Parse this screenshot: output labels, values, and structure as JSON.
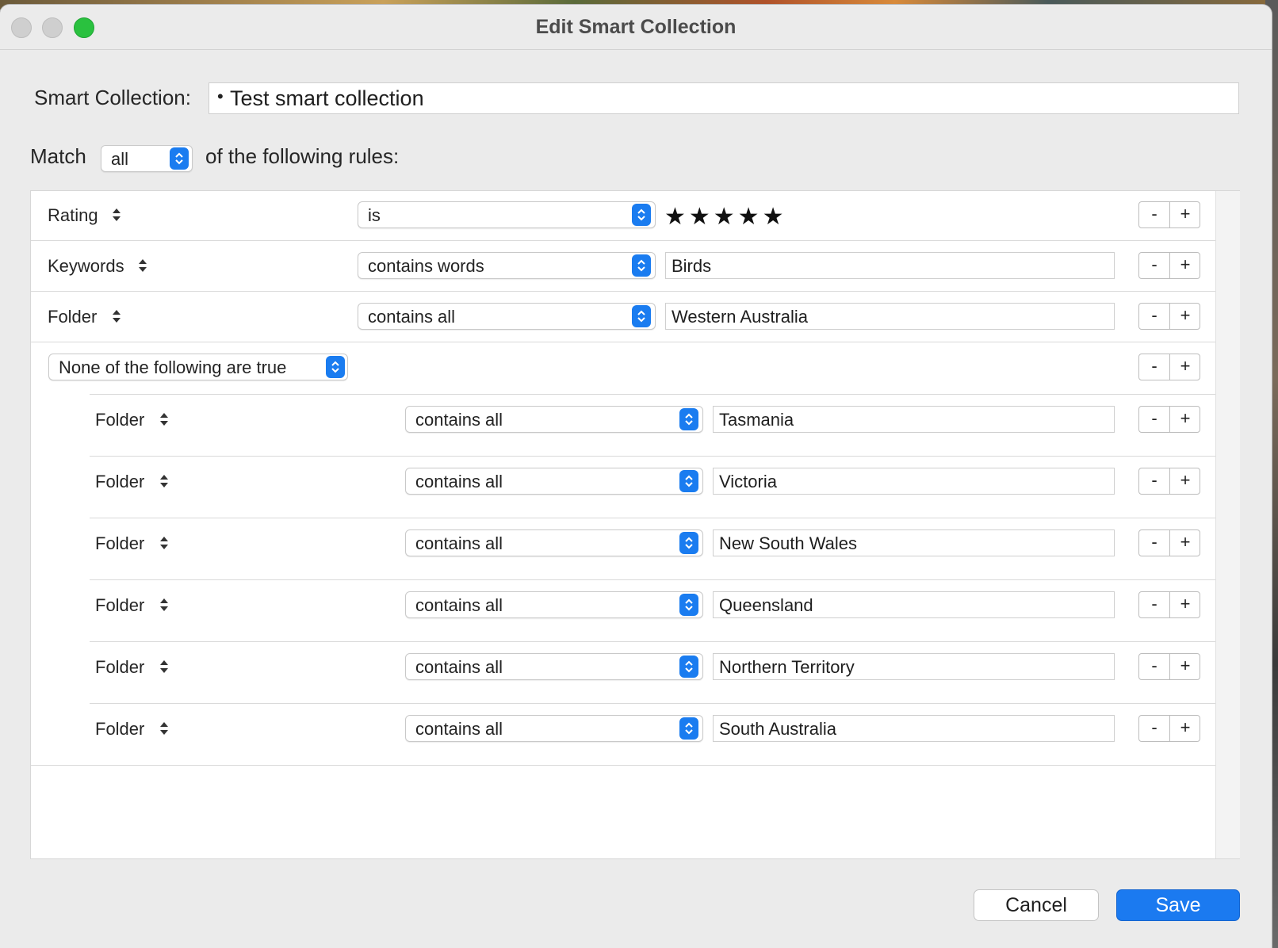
{
  "window": {
    "title": "Edit Smart Collection"
  },
  "name": {
    "label": "Smart Collection:",
    "bullet": "•",
    "value": "Test smart collection"
  },
  "match": {
    "prefix": "Match",
    "value": "all",
    "suffix": "of the following rules:"
  },
  "rules": [
    {
      "criterion": "Rating",
      "operator": "is",
      "stars": "★★★★★",
      "rating": 5
    },
    {
      "criterion": "Keywords",
      "operator": "contains words",
      "value": "Birds"
    },
    {
      "criterion": "Folder",
      "operator": "contains all",
      "value": "Western Australia"
    }
  ],
  "group": {
    "selector": "None of the following are true",
    "rules": [
      {
        "criterion": "Folder",
        "operator": "contains all",
        "value": "Tasmania"
      },
      {
        "criterion": "Folder",
        "operator": "contains all",
        "value": "Victoria"
      },
      {
        "criterion": "Folder",
        "operator": "contains all",
        "value": "New South Wales"
      },
      {
        "criterion": "Folder",
        "operator": "contains all",
        "value": "Queensland"
      },
      {
        "criterion": "Folder",
        "operator": "contains all",
        "value": "Northern Territory"
      },
      {
        "criterion": "Folder",
        "operator": "contains all",
        "value": "South Australia"
      }
    ]
  },
  "buttons": {
    "minus": "-",
    "plus": "+",
    "cancel": "Cancel",
    "save": "Save"
  },
  "colors": {
    "accent": "#1b7af0",
    "zoom_light": "#2ac13f"
  }
}
